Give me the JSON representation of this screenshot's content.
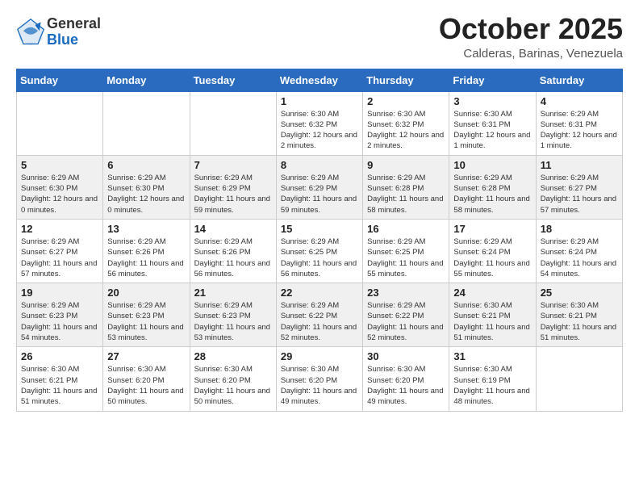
{
  "logo": {
    "general": "General",
    "blue": "Blue"
  },
  "header": {
    "month": "October 2025",
    "location": "Calderas, Barinas, Venezuela"
  },
  "weekdays": [
    "Sunday",
    "Monday",
    "Tuesday",
    "Wednesday",
    "Thursday",
    "Friday",
    "Saturday"
  ],
  "weeks": [
    [
      {
        "day": "",
        "info": ""
      },
      {
        "day": "",
        "info": ""
      },
      {
        "day": "",
        "info": ""
      },
      {
        "day": "1",
        "info": "Sunrise: 6:30 AM\nSunset: 6:32 PM\nDaylight: 12 hours and 2 minutes."
      },
      {
        "day": "2",
        "info": "Sunrise: 6:30 AM\nSunset: 6:32 PM\nDaylight: 12 hours and 2 minutes."
      },
      {
        "day": "3",
        "info": "Sunrise: 6:30 AM\nSunset: 6:31 PM\nDaylight: 12 hours and 1 minute."
      },
      {
        "day": "4",
        "info": "Sunrise: 6:29 AM\nSunset: 6:31 PM\nDaylight: 12 hours and 1 minute."
      }
    ],
    [
      {
        "day": "5",
        "info": "Sunrise: 6:29 AM\nSunset: 6:30 PM\nDaylight: 12 hours and 0 minutes."
      },
      {
        "day": "6",
        "info": "Sunrise: 6:29 AM\nSunset: 6:30 PM\nDaylight: 12 hours and 0 minutes."
      },
      {
        "day": "7",
        "info": "Sunrise: 6:29 AM\nSunset: 6:29 PM\nDaylight: 11 hours and 59 minutes."
      },
      {
        "day": "8",
        "info": "Sunrise: 6:29 AM\nSunset: 6:29 PM\nDaylight: 11 hours and 59 minutes."
      },
      {
        "day": "9",
        "info": "Sunrise: 6:29 AM\nSunset: 6:28 PM\nDaylight: 11 hours and 58 minutes."
      },
      {
        "day": "10",
        "info": "Sunrise: 6:29 AM\nSunset: 6:28 PM\nDaylight: 11 hours and 58 minutes."
      },
      {
        "day": "11",
        "info": "Sunrise: 6:29 AM\nSunset: 6:27 PM\nDaylight: 11 hours and 57 minutes."
      }
    ],
    [
      {
        "day": "12",
        "info": "Sunrise: 6:29 AM\nSunset: 6:27 PM\nDaylight: 11 hours and 57 minutes."
      },
      {
        "day": "13",
        "info": "Sunrise: 6:29 AM\nSunset: 6:26 PM\nDaylight: 11 hours and 56 minutes."
      },
      {
        "day": "14",
        "info": "Sunrise: 6:29 AM\nSunset: 6:26 PM\nDaylight: 11 hours and 56 minutes."
      },
      {
        "day": "15",
        "info": "Sunrise: 6:29 AM\nSunset: 6:25 PM\nDaylight: 11 hours and 56 minutes."
      },
      {
        "day": "16",
        "info": "Sunrise: 6:29 AM\nSunset: 6:25 PM\nDaylight: 11 hours and 55 minutes."
      },
      {
        "day": "17",
        "info": "Sunrise: 6:29 AM\nSunset: 6:24 PM\nDaylight: 11 hours and 55 minutes."
      },
      {
        "day": "18",
        "info": "Sunrise: 6:29 AM\nSunset: 6:24 PM\nDaylight: 11 hours and 54 minutes."
      }
    ],
    [
      {
        "day": "19",
        "info": "Sunrise: 6:29 AM\nSunset: 6:23 PM\nDaylight: 11 hours and 54 minutes."
      },
      {
        "day": "20",
        "info": "Sunrise: 6:29 AM\nSunset: 6:23 PM\nDaylight: 11 hours and 53 minutes."
      },
      {
        "day": "21",
        "info": "Sunrise: 6:29 AM\nSunset: 6:23 PM\nDaylight: 11 hours and 53 minutes."
      },
      {
        "day": "22",
        "info": "Sunrise: 6:29 AM\nSunset: 6:22 PM\nDaylight: 11 hours and 52 minutes."
      },
      {
        "day": "23",
        "info": "Sunrise: 6:29 AM\nSunset: 6:22 PM\nDaylight: 11 hours and 52 minutes."
      },
      {
        "day": "24",
        "info": "Sunrise: 6:30 AM\nSunset: 6:21 PM\nDaylight: 11 hours and 51 minutes."
      },
      {
        "day": "25",
        "info": "Sunrise: 6:30 AM\nSunset: 6:21 PM\nDaylight: 11 hours and 51 minutes."
      }
    ],
    [
      {
        "day": "26",
        "info": "Sunrise: 6:30 AM\nSunset: 6:21 PM\nDaylight: 11 hours and 51 minutes."
      },
      {
        "day": "27",
        "info": "Sunrise: 6:30 AM\nSunset: 6:20 PM\nDaylight: 11 hours and 50 minutes."
      },
      {
        "day": "28",
        "info": "Sunrise: 6:30 AM\nSunset: 6:20 PM\nDaylight: 11 hours and 50 minutes."
      },
      {
        "day": "29",
        "info": "Sunrise: 6:30 AM\nSunset: 6:20 PM\nDaylight: 11 hours and 49 minutes."
      },
      {
        "day": "30",
        "info": "Sunrise: 6:30 AM\nSunset: 6:20 PM\nDaylight: 11 hours and 49 minutes."
      },
      {
        "day": "31",
        "info": "Sunrise: 6:30 AM\nSunset: 6:19 PM\nDaylight: 11 hours and 48 minutes."
      },
      {
        "day": "",
        "info": ""
      }
    ]
  ]
}
